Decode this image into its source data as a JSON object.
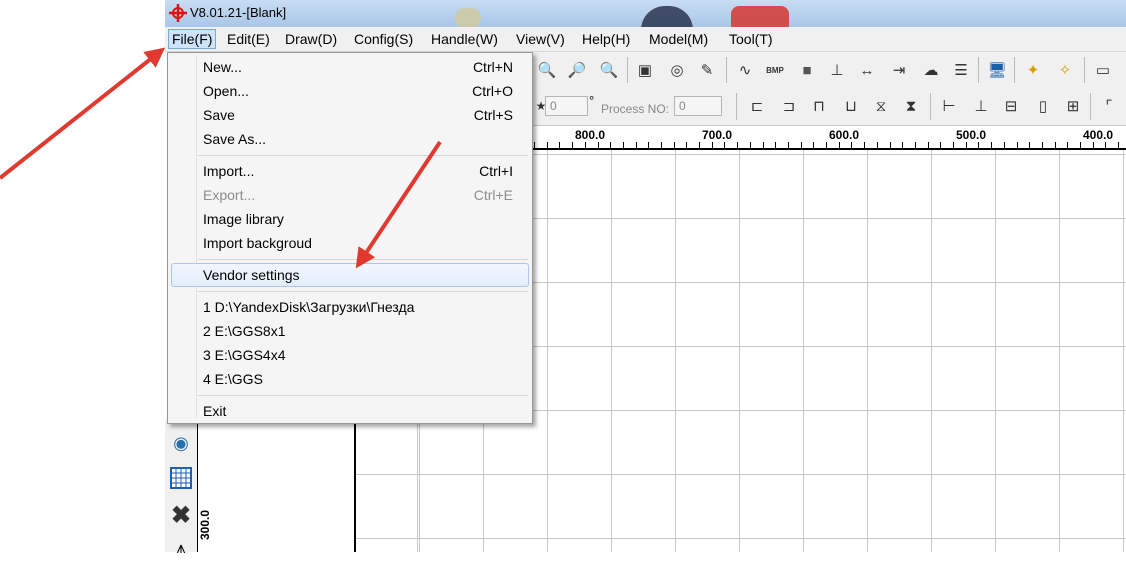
{
  "window": {
    "title": "V8.01.21-[Blank]"
  },
  "menubar": {
    "items": [
      "File(F)",
      "Edit(E)",
      "Draw(D)",
      "Config(S)",
      "Handle(W)",
      "View(V)",
      "Help(H)",
      "Model(M)",
      "Tool(T)"
    ]
  },
  "file_menu": {
    "new": {
      "label": "New...",
      "shortcut": "Ctrl+N"
    },
    "open": {
      "label": "Open...",
      "shortcut": "Ctrl+O"
    },
    "save": {
      "label": "Save",
      "shortcut": "Ctrl+S"
    },
    "save_as": {
      "label": "Save As..."
    },
    "import": {
      "label": "Import...",
      "shortcut": "Ctrl+I"
    },
    "export": {
      "label": "Export...",
      "shortcut": "Ctrl+E"
    },
    "image_library": {
      "label": "Image library"
    },
    "import_background": {
      "label": "Import backgroud"
    },
    "vendor_settings": {
      "label": "Vendor settings"
    },
    "recent": [
      "1 D:\\YandexDisk\\Загрузки\\Гнезда",
      "2 E:\\GGS8x1",
      "3 E:\\GGS4x4",
      "4 E:\\GGS"
    ],
    "exit": {
      "label": "Exit"
    }
  },
  "toolbar2": {
    "angle_value": "0",
    "degree_symbol": "°",
    "process_label": "Process NO:",
    "process_value": "0"
  },
  "ruler": {
    "labels": [
      "800.0",
      "700.0",
      "600.0",
      "500.0",
      "400.0"
    ],
    "vertical_label": "300.0"
  },
  "colors": {
    "arrow": "#e03a2f",
    "menu_highlight": "#cfe3fb",
    "title_bar": "#b9d1ee"
  }
}
